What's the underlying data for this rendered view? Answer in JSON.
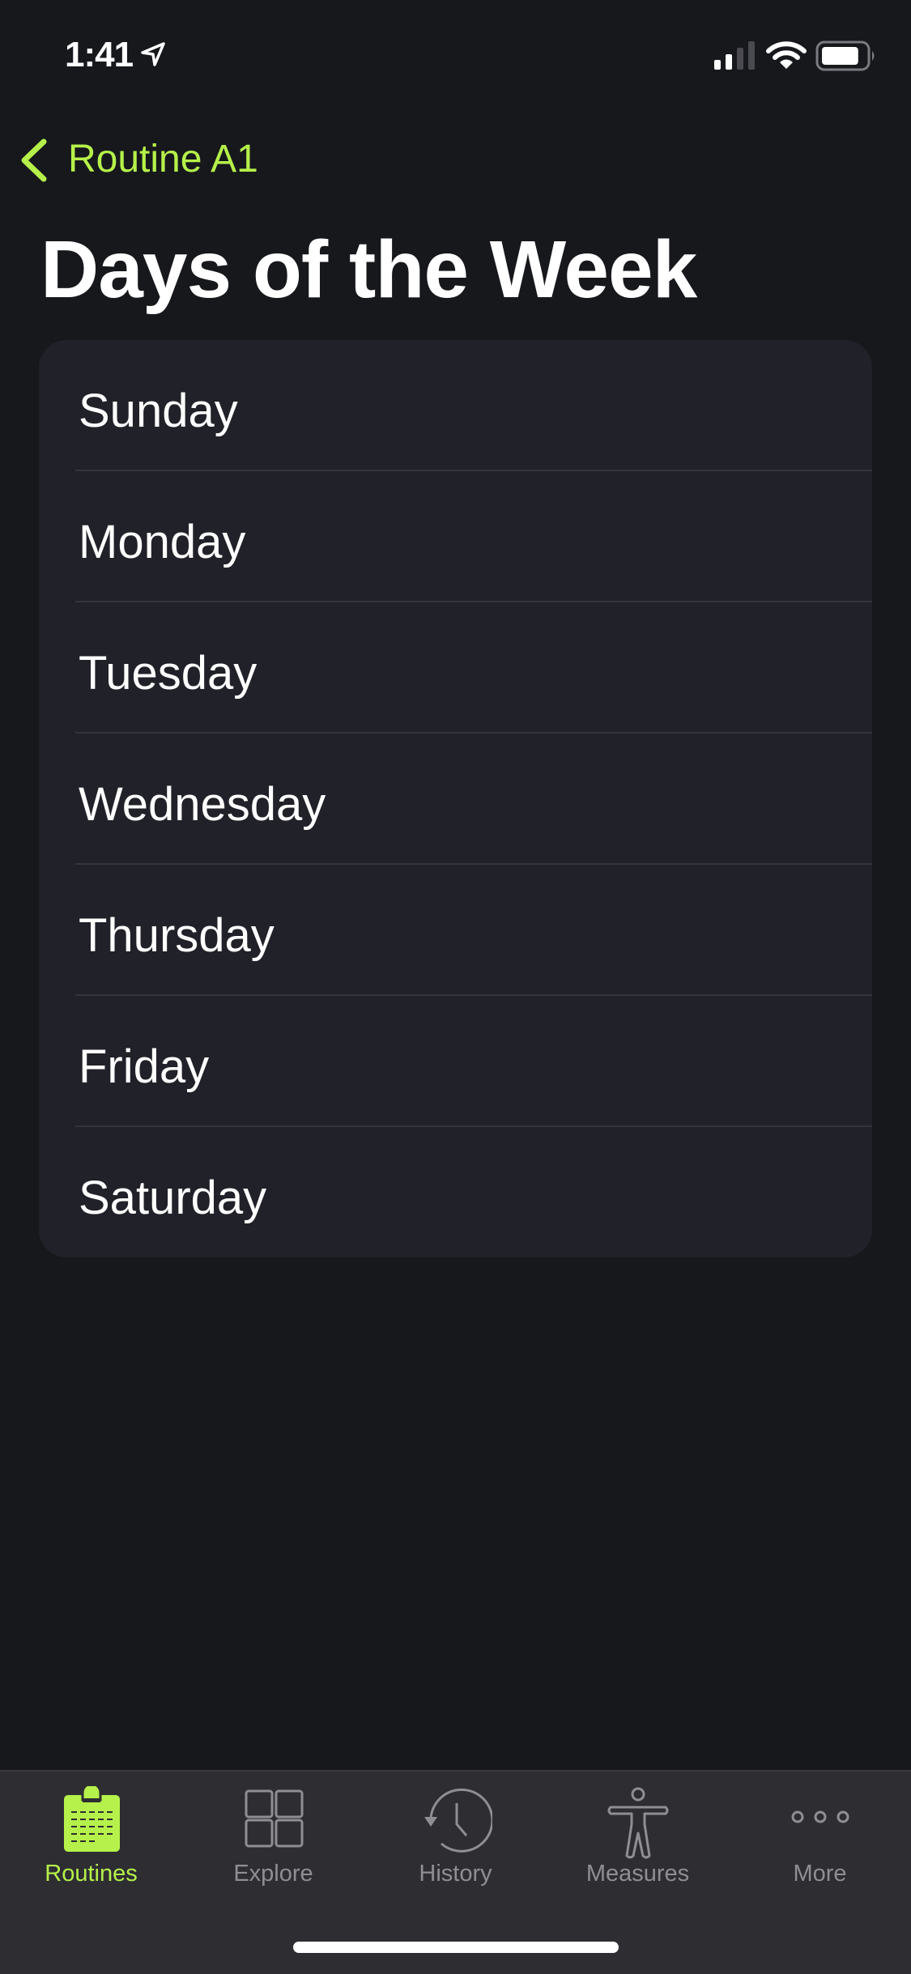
{
  "status_bar": {
    "time": "1:41",
    "location_icon": "location-arrow-icon",
    "signal_bars_filled": 2,
    "signal_bars_total": 4,
    "wifi_icon": "wifi-icon",
    "battery_level_percent": 80
  },
  "nav": {
    "back_icon": "chevron-left-icon",
    "back_label": "Routine A1"
  },
  "page": {
    "title": "Days of the Week"
  },
  "days": [
    {
      "label": "Sunday"
    },
    {
      "label": "Monday"
    },
    {
      "label": "Tuesday"
    },
    {
      "label": "Wednesday"
    },
    {
      "label": "Thursday"
    },
    {
      "label": "Friday"
    },
    {
      "label": "Saturday"
    }
  ],
  "tab_bar": {
    "active_index": 0,
    "tabs": [
      {
        "label": "Routines",
        "icon": "clipboard-icon"
      },
      {
        "label": "Explore",
        "icon": "grid-icon"
      },
      {
        "label": "History",
        "icon": "history-clock-icon"
      },
      {
        "label": "Measures",
        "icon": "body-figure-icon"
      },
      {
        "label": "More",
        "icon": "more-dots-icon"
      }
    ]
  },
  "colors": {
    "accent": "#b5f14a",
    "background": "#17181c",
    "card": "#212129",
    "tab_bar": "#2e2d32",
    "inactive_tab": "#8e8e93"
  }
}
